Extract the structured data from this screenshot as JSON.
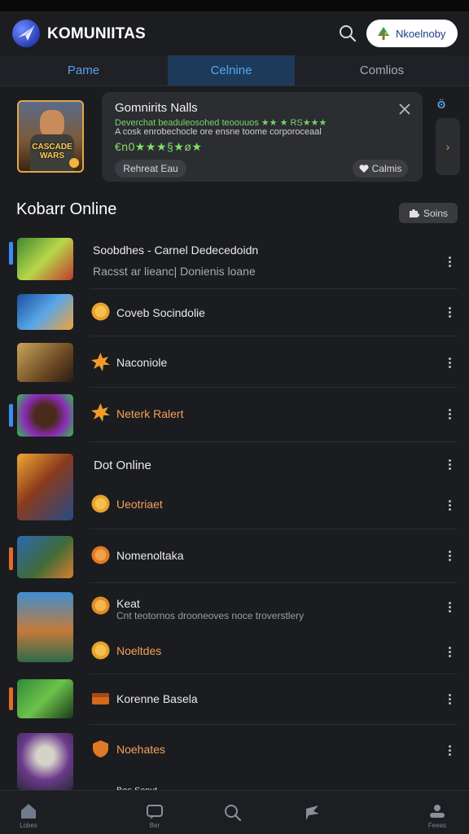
{
  "app": {
    "title": "KOMUNIITAS",
    "header_button_label": "Nkoelnoby"
  },
  "tabs": [
    {
      "label": "Pame"
    },
    {
      "label": "Celnine"
    },
    {
      "label": "Comlios"
    }
  ],
  "notification": {
    "title": "Gomnirits Nalls",
    "line1": "Deverchat beaduleosohed teoouuos ★★ ★ RS★★★",
    "line2": "A cosk enrobechocle ore ensne toome corporoceaal",
    "line3": "€n0★★★§★ø★",
    "button_primary": "Rehreat Eau",
    "button_secondary": "Calmis"
  },
  "hero_thumb_caption": "CASCADE WARS",
  "section": {
    "title": "Kobarr Online",
    "button_label": "Soins"
  },
  "items": [
    {
      "label": "Soobdhes - Carnel Dedecedoidn",
      "sub": "Racsst ar lieanc| Donienis loane"
    },
    {
      "label": "Coveb Socindolie"
    },
    {
      "label": "Naconiole"
    },
    {
      "label": "Neterk Ralert"
    },
    {
      "label": "Dot Online",
      "sub_label": "Ueotriaet"
    },
    {
      "label": "Nomenoltaka"
    },
    {
      "label": "Keat",
      "sub": "Cnt teotornos drooneoves noce troverstlery",
      "sub_label": "Noeltdes"
    },
    {
      "label": "Korenne Basela"
    },
    {
      "label": "Noehates"
    },
    {
      "label": "Bos Scout"
    }
  ],
  "bottom_nav": [
    {
      "label": "Lobes",
      "icon": "home-icon"
    },
    {
      "label": "Ber",
      "icon": "chat-icon"
    },
    {
      "label": "",
      "icon": "search-icon"
    },
    {
      "label": "",
      "icon": "flag-icon"
    },
    {
      "label": "Feeas",
      "icon": "profile-icon"
    }
  ],
  "colors": {
    "accent_blue": "#56a8f2",
    "accent_orange": "#f2a15a",
    "notif_green": "#77d36a",
    "background": "#1b1c1f"
  }
}
